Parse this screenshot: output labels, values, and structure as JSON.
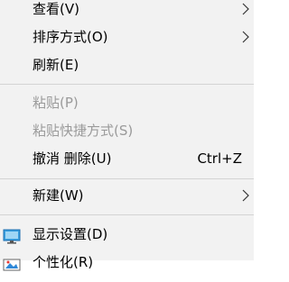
{
  "context_menu": {
    "items": [
      {
        "label": "查看(V)",
        "has_submenu": true,
        "disabled": false
      },
      {
        "label": "排序方式(O)",
        "has_submenu": true,
        "disabled": false
      },
      {
        "label": "刷新(E)",
        "has_submenu": false,
        "disabled": false
      },
      {
        "label": "粘贴(P)",
        "has_submenu": false,
        "disabled": true
      },
      {
        "label": "粘贴快捷方式(S)",
        "has_submenu": false,
        "disabled": true
      },
      {
        "label": "撤消 删除(U)",
        "shortcut": "Ctrl+Z",
        "has_submenu": false,
        "disabled": false
      },
      {
        "label": "新建(W)",
        "has_submenu": true,
        "disabled": false
      },
      {
        "label": "显示设置(D)",
        "icon": "display-icon",
        "has_submenu": false,
        "disabled": false
      },
      {
        "label": "个性化(R)",
        "icon": "personalize-icon",
        "has_submenu": false,
        "disabled": false
      }
    ]
  },
  "colors": {
    "menu_background": "#f2f2f2",
    "disabled_text": "#9a9a9a",
    "separator": "#d4d4d4"
  }
}
